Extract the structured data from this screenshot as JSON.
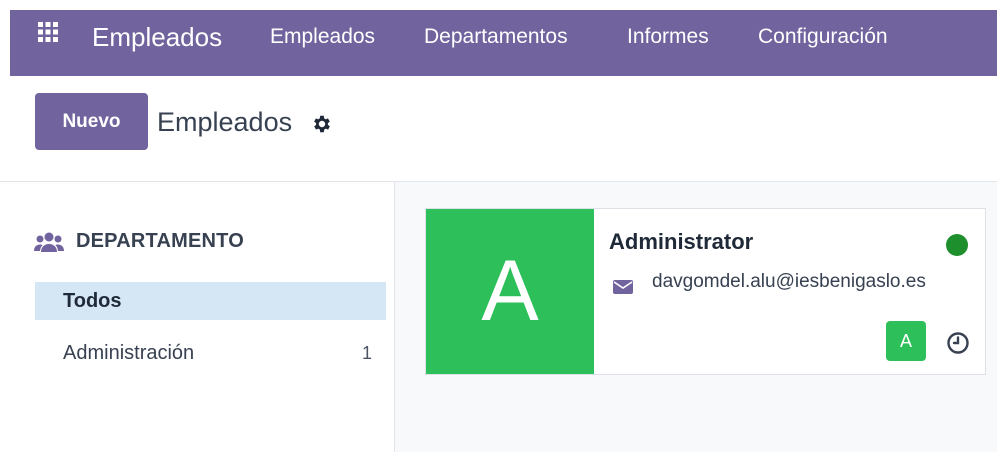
{
  "navbar": {
    "app_name": "Empleados",
    "menu": [
      "Empleados",
      "Departamentos",
      "Informes",
      "Configuración"
    ],
    "background": "#71639e"
  },
  "control": {
    "new_label": "Nuevo",
    "breadcrumb": "Empleados"
  },
  "sidebar": {
    "section_title": "DEPARTAMENTO",
    "items": [
      {
        "label": "Todos",
        "count": ""
      },
      {
        "label": "Administración",
        "count": "1"
      }
    ]
  },
  "employee_card": {
    "initial": "A",
    "name": "Administrator",
    "email": "davgomdel.alu@iesbenigaslo.es",
    "badge_initial": "A",
    "avatar_color": "#2dbf5a",
    "status_color": "#1d8f2c"
  }
}
